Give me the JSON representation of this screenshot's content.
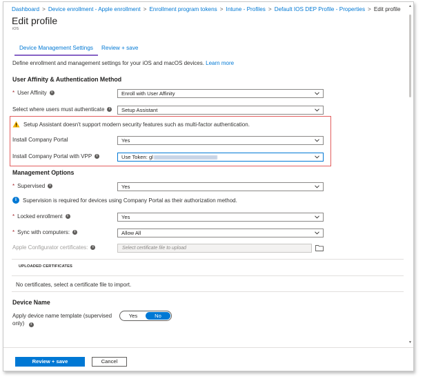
{
  "breadcrumb": {
    "items": [
      "Dashboard",
      "Device enrollment - Apple enrollment",
      "Enrollment program tokens",
      "Intune - Profiles",
      "Default IOS DEP Profile - Properties"
    ],
    "current": "Edit profile",
    "separator": ">"
  },
  "header": {
    "title": "Edit profile",
    "subtitle": "iOS"
  },
  "tabs": [
    {
      "label": "Device Management Settings",
      "active": true
    },
    {
      "label": "Review + save",
      "active": false
    }
  ],
  "intro": {
    "text": "Define enrollment and management settings for your iOS and macOS devices.",
    "link": "Learn more"
  },
  "sections": {
    "affinity": {
      "title": "User Affinity & Authentication Method"
    },
    "management": {
      "title": "Management Options"
    },
    "device_name": {
      "title": "Device Name"
    }
  },
  "fields": {
    "user_affinity": {
      "label": "User Affinity",
      "value": "Enroll with User Affinity",
      "required": true
    },
    "authenticate": {
      "label": "Select where users must authenticate",
      "value": "Setup Assistant"
    },
    "install_cp": {
      "label": "Install Company Portal",
      "value": "Yes"
    },
    "install_cp_vpp": {
      "label": "Install Company Portal with VPP",
      "value": "Use Token: gl"
    },
    "supervised": {
      "label": "Supervised",
      "value": "Yes",
      "required": true
    },
    "locked": {
      "label": "Locked enrollment",
      "value": "Yes",
      "required": true
    },
    "sync": {
      "label": "Sync with computers:",
      "value": "Allow All",
      "required": true
    },
    "configurator": {
      "label": "Apple Configurator certificates:",
      "placeholder": "Select certificate file to upload"
    },
    "apply_name": {
      "label": "Apply device name template (supervised only)",
      "options": [
        "Yes",
        "No"
      ],
      "selected": "No"
    }
  },
  "messages": {
    "warning": "Setup Assistant doesn't support modern security features such as multi-factor authentication.",
    "info": "Supervision is required for devices using Company Portal as their authorization method."
  },
  "certificates": {
    "header": "UPLOADED CERTIFICATES",
    "empty": "No certificates, select a certificate file to import."
  },
  "footer": {
    "primary": "Review + save",
    "secondary": "Cancel"
  },
  "colors": {
    "accent": "#0078d4",
    "tab_underline": "#8661c5",
    "warning_box": "#e25d5d",
    "required": "#a4262c",
    "warning_icon": "#f2b200"
  },
  "icons": {
    "info": "info-icon",
    "warning": "warning-icon",
    "chevron": "chevron-down-icon",
    "folder": "folder-icon"
  }
}
